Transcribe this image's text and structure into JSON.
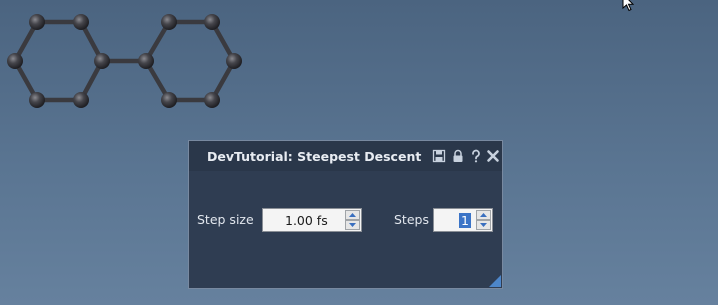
{
  "panel": {
    "title": "DevTutorial: Steepest Descent",
    "header_icons": [
      "save-icon",
      "lock-icon",
      "help-icon",
      "close-icon"
    ]
  },
  "fields": {
    "step_size": {
      "label": "Step size",
      "value": "1.00 fs"
    },
    "steps": {
      "label": "Steps",
      "value": "1"
    }
  },
  "viewport": {
    "molecule": "biphenyl",
    "atom_color": "#3a3a3e",
    "background_color": "#54708d"
  },
  "colors": {
    "panel_bg": "#2f3d52",
    "selection": "#3b74c7"
  }
}
